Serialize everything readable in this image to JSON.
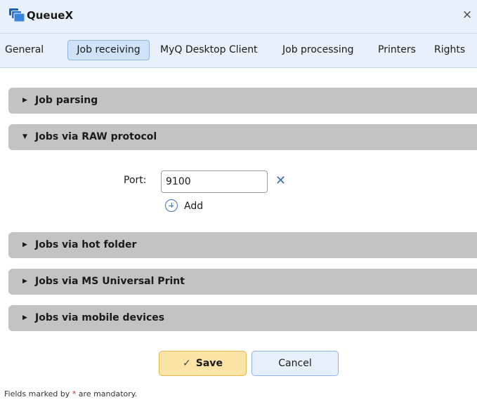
{
  "window": {
    "title": "QueueX",
    "close_icon": "close-icon",
    "app_icon": "queue-icon",
    "close_glyph": "×"
  },
  "tabs": [
    {
      "label": "General",
      "active": false
    },
    {
      "label": "Job receiving",
      "active": true
    },
    {
      "label": "MyQ Desktop Client",
      "active": false
    },
    {
      "label": "Job processing",
      "active": false
    },
    {
      "label": "Printers",
      "active": false
    },
    {
      "label": "Rights",
      "active": false
    }
  ],
  "sections": [
    {
      "label": "Job parsing",
      "expanded": false
    },
    {
      "label": "Jobs via RAW protocol",
      "expanded": true
    },
    {
      "label": "Jobs via hot folder",
      "expanded": false
    },
    {
      "label": "Jobs via MS Universal Print",
      "expanded": false
    },
    {
      "label": "Jobs via mobile devices",
      "expanded": false
    }
  ],
  "raw_protocol": {
    "port_label": "Port:",
    "port_value": "9100",
    "remove_glyph": "✕",
    "add_label": "Add"
  },
  "glyphs": {
    "collapsed": "▶",
    "expanded": "▼",
    "check": "✓"
  },
  "buttons": {
    "save_label": "Save",
    "cancel_label": "Cancel"
  },
  "footnote": {
    "prefix": "Fields marked by ",
    "marker": "*",
    "suffix": " are mandatory."
  },
  "colors": {
    "accent": "#3a6fb5",
    "titlebar_bg": "#e8f1fb",
    "section_bg": "#c3c3c3",
    "save_bg": "#fce3a6",
    "cancel_bg": "#e6f0fb",
    "required": "#dd2222"
  }
}
